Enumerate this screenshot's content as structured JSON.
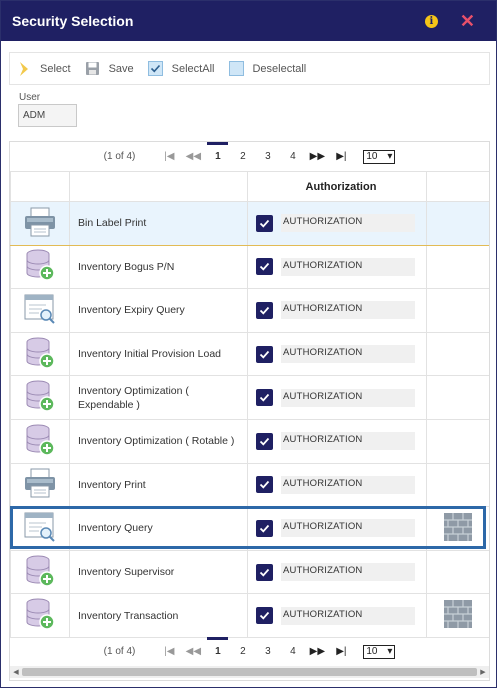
{
  "window": {
    "title": "Security Selection"
  },
  "toolbar": {
    "select_label": "Select",
    "save_label": "Save",
    "selectall_label": "SelectAll",
    "deselectall_label": "Deselectall"
  },
  "user": {
    "label": "User",
    "value": "ADM"
  },
  "pager": {
    "info": "(1 of 4)",
    "pages": [
      "1",
      "2",
      "3",
      "4"
    ],
    "active_page": "1",
    "page_size": "10"
  },
  "table": {
    "headers": {
      "authorization": "Authorization"
    },
    "rows": [
      {
        "icon": "printer-icon",
        "name": "Bin Label Print",
        "auth": "AUTHORIZATION",
        "checked": true,
        "ext": ""
      },
      {
        "icon": "database-add-icon",
        "name": "Inventory Bogus P/N",
        "auth": "AUTHORIZATION",
        "checked": true,
        "ext": ""
      },
      {
        "icon": "query-window-icon",
        "name": "Inventory Expiry Query",
        "auth": "AUTHORIZATION",
        "checked": true,
        "ext": ""
      },
      {
        "icon": "database-add-icon",
        "name": "Inventory Initial Provision Load",
        "auth": "AUTHORIZATION",
        "checked": true,
        "ext": ""
      },
      {
        "icon": "database-add-icon",
        "name": "Inventory Optimization ( Expendable )",
        "auth": "AUTHORIZATION",
        "checked": true,
        "ext": ""
      },
      {
        "icon": "database-add-icon",
        "name": "Inventory Optimization ( Rotable )",
        "auth": "AUTHORIZATION",
        "checked": true,
        "ext": ""
      },
      {
        "icon": "printer-icon",
        "name": "Inventory Print",
        "auth": "AUTHORIZATION",
        "checked": true,
        "ext": ""
      },
      {
        "icon": "query-window-icon",
        "name": "Inventory Query",
        "auth": "AUTHORIZATION",
        "checked": true,
        "ext": "brick-wall-icon"
      },
      {
        "icon": "database-add-icon",
        "name": "Inventory Supervisor",
        "auth": "AUTHORIZATION",
        "checked": true,
        "ext": ""
      },
      {
        "icon": "database-add-icon",
        "name": "Inventory Transaction",
        "auth": "AUTHORIZATION",
        "checked": true,
        "ext": "brick-wall-icon"
      }
    ]
  },
  "colors": {
    "titlebar": "#1f2063",
    "checkbox": "#1f2063",
    "highlight": "#2d68a8",
    "selected_row": "#e9f4fd"
  }
}
